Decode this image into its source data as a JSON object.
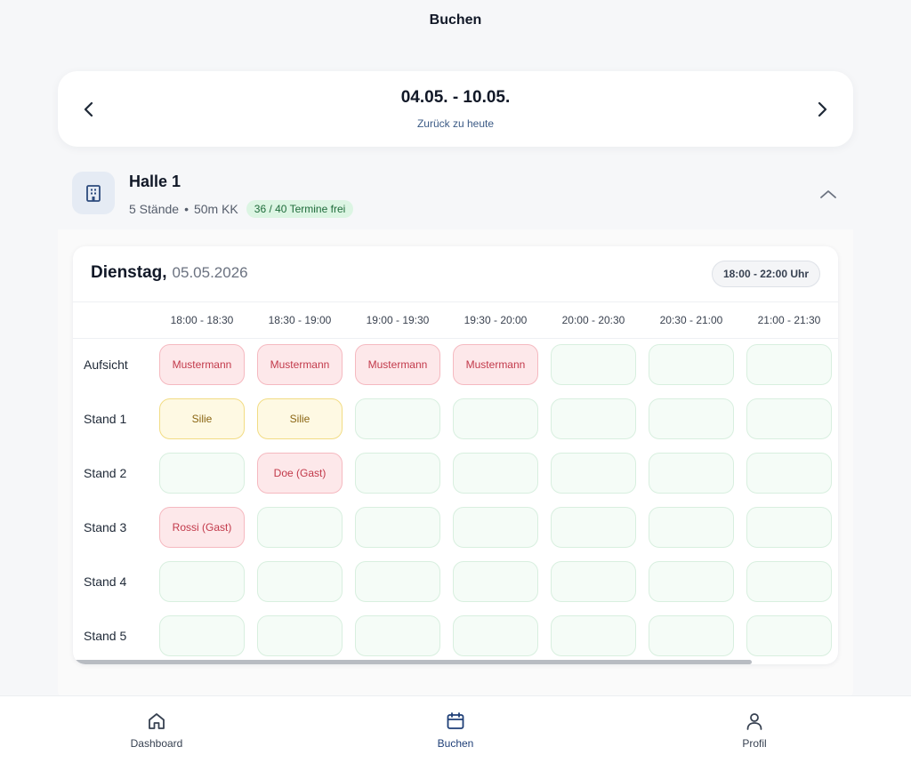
{
  "page": {
    "title": "Buchen"
  },
  "week": {
    "range": "04.05. - 10.05.",
    "back_to_today": "Zurück zu heute"
  },
  "hall": {
    "title": "Halle 1",
    "stands": "5 Stände",
    "distance": "50m KK",
    "free_badge": "36 / 40 Termine frei"
  },
  "day": {
    "name": "Dienstag,",
    "date": "05.05.2026",
    "time_range": "18:00 - 22:00 Uhr"
  },
  "columns": [
    "18:00 - 18:30",
    "18:30 - 19:00",
    "19:00 - 19:30",
    "19:30 - 20:00",
    "20:00 - 20:30",
    "20:30 - 21:00",
    "21:00 - 21:30"
  ],
  "rows": [
    {
      "label": "Aufsicht",
      "slots": [
        {
          "state": "booked",
          "text": "Mustermann"
        },
        {
          "state": "booked",
          "text": "Mustermann"
        },
        {
          "state": "booked",
          "text": "Mustermann"
        },
        {
          "state": "booked",
          "text": "Mustermann"
        },
        {
          "state": "free",
          "text": ""
        },
        {
          "state": "free",
          "text": ""
        },
        {
          "state": "free",
          "text": ""
        }
      ]
    },
    {
      "label": "Stand 1",
      "slots": [
        {
          "state": "own",
          "text": "Silie"
        },
        {
          "state": "own",
          "text": "Silie"
        },
        {
          "state": "free",
          "text": ""
        },
        {
          "state": "free",
          "text": ""
        },
        {
          "state": "free",
          "text": ""
        },
        {
          "state": "free",
          "text": ""
        },
        {
          "state": "free",
          "text": ""
        }
      ]
    },
    {
      "label": "Stand 2",
      "slots": [
        {
          "state": "free",
          "text": ""
        },
        {
          "state": "booked",
          "text": "Doe (Gast)"
        },
        {
          "state": "free",
          "text": ""
        },
        {
          "state": "free",
          "text": ""
        },
        {
          "state": "free",
          "text": ""
        },
        {
          "state": "free",
          "text": ""
        },
        {
          "state": "free",
          "text": ""
        }
      ]
    },
    {
      "label": "Stand 3",
      "slots": [
        {
          "state": "booked",
          "text": "Rossi (Gast)"
        },
        {
          "state": "free",
          "text": ""
        },
        {
          "state": "free",
          "text": ""
        },
        {
          "state": "free",
          "text": ""
        },
        {
          "state": "free",
          "text": ""
        },
        {
          "state": "free",
          "text": ""
        },
        {
          "state": "free",
          "text": ""
        }
      ]
    },
    {
      "label": "Stand 4",
      "slots": [
        {
          "state": "free",
          "text": ""
        },
        {
          "state": "free",
          "text": ""
        },
        {
          "state": "free",
          "text": ""
        },
        {
          "state": "free",
          "text": ""
        },
        {
          "state": "free",
          "text": ""
        },
        {
          "state": "free",
          "text": ""
        },
        {
          "state": "free",
          "text": ""
        }
      ]
    },
    {
      "label": "Stand 5",
      "slots": [
        {
          "state": "free",
          "text": ""
        },
        {
          "state": "free",
          "text": ""
        },
        {
          "state": "free",
          "text": ""
        },
        {
          "state": "free",
          "text": ""
        },
        {
          "state": "free",
          "text": ""
        },
        {
          "state": "free",
          "text": ""
        },
        {
          "state": "free",
          "text": ""
        }
      ]
    }
  ],
  "bottom_nav": [
    {
      "label": "Dashboard",
      "icon": "home-icon",
      "active": false
    },
    {
      "label": "Buchen",
      "icon": "calendar-icon",
      "active": true
    },
    {
      "label": "Profil",
      "icon": "user-icon",
      "active": false
    }
  ],
  "colors": {
    "accent": "#1f3f77",
    "booked_bg": "#fde8ea",
    "booked_text": "#c2394a",
    "own_bg": "#fef9e3",
    "own_text": "#8a6512",
    "free_bg": "#f5fcf7",
    "badge_bg": "#dcf5e3"
  }
}
